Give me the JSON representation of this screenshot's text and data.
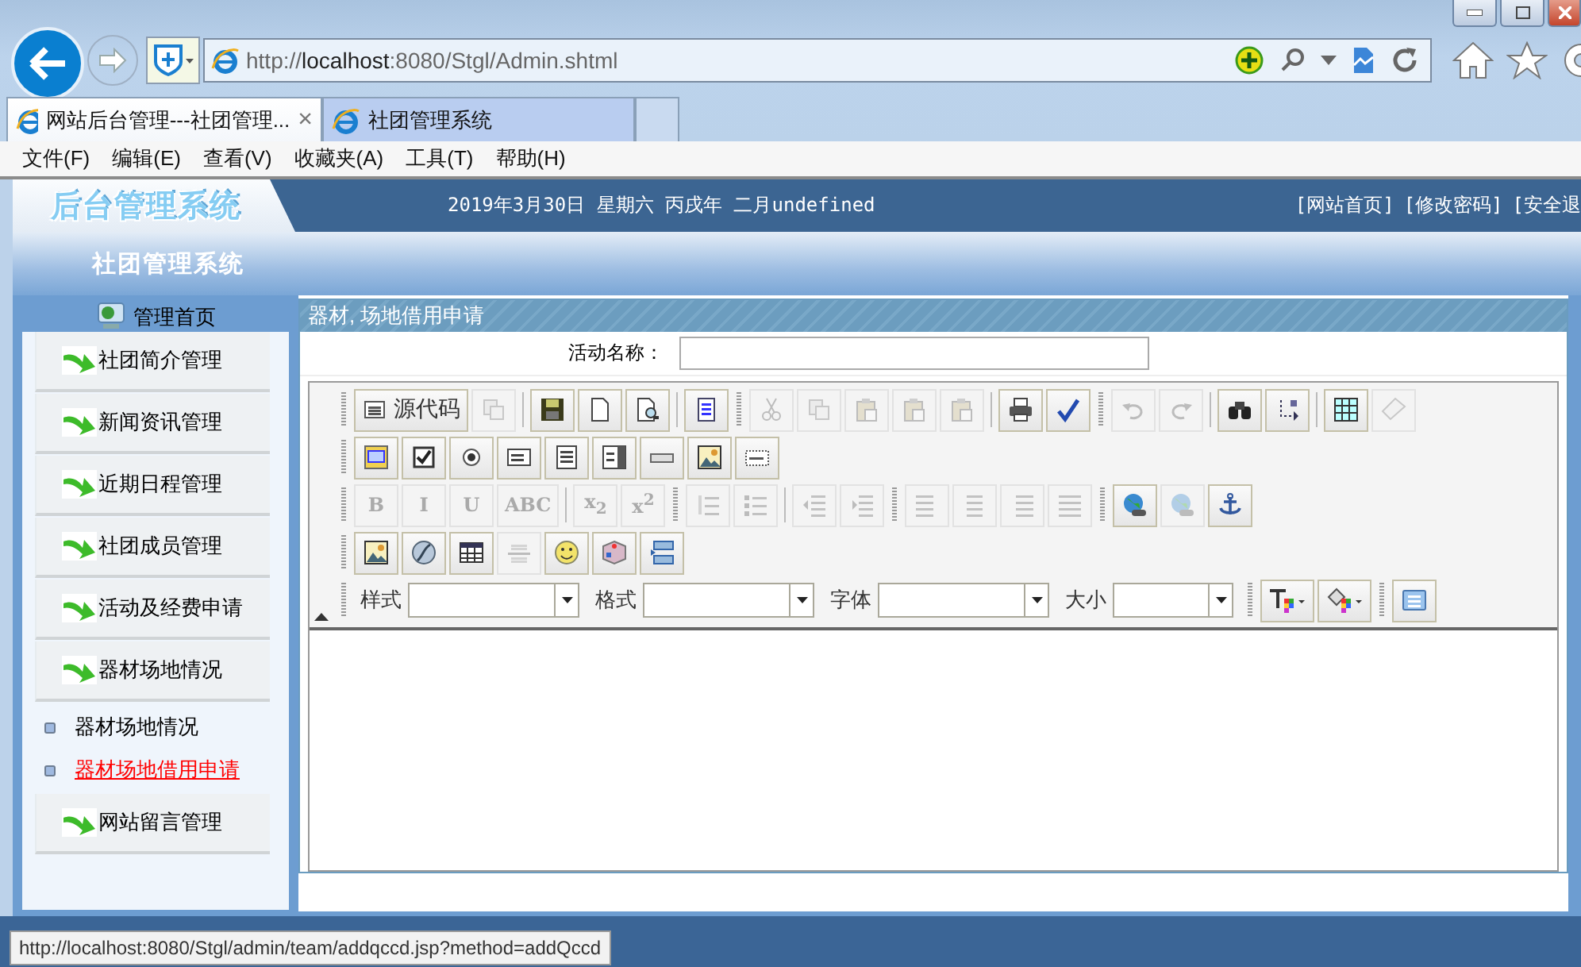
{
  "browser": {
    "address": "http://**localhost**:8080/Stgl/Admin.shtml",
    "tabs": [
      {
        "title": "网站后台管理---社团管理...",
        "selected": true,
        "close": "×"
      },
      {
        "title": "社团管理系统",
        "selected": false
      }
    ],
    "menu": [
      "文件(F)",
      "编辑(E)",
      "查看(V)",
      "收藏夹(A)",
      "工具(T)",
      "帮助(H)"
    ],
    "status_tooltip": "http://localhost:8080/Stgl/admin/team/addqccd.jsp?method=addQccd"
  },
  "header": {
    "logo": "后台管理系统",
    "date": "2019年3月30日 星期六 丙戌年 二月undefined",
    "links": [
      "[网站首页]",
      "[修改密码]",
      "[安全退"
    ],
    "system_title": "社团管理系统"
  },
  "sidebar": {
    "home": "管理首页",
    "items": [
      {
        "label": "社团简介管理"
      },
      {
        "label": "新闻资讯管理"
      },
      {
        "label": "近期日程管理"
      },
      {
        "label": "社团成员管理"
      },
      {
        "label": "活动及经费申请"
      },
      {
        "label": "器材场地情况",
        "children": [
          {
            "label": "器材场地情况",
            "selected": false
          },
          {
            "label": "器材场地借用申请",
            "selected": true
          }
        ]
      },
      {
        "label": "网站留言管理"
      }
    ]
  },
  "panel": {
    "title": "器材, 场地借用申请",
    "field_label": "活动名称：",
    "editor": {
      "rows": [
        {
          "toolbars": [
            {
              "groups": [
                [
                  {
                    "kind": "button",
                    "label": "源代码",
                    "disabled": false
                  },
                  {
                    "kind": "button",
                    "disabled": true
                  }
                ],
                [
                  {
                    "kind": "button",
                    "disabled": false
                  },
                  {
                    "kind": "button",
                    "disabled": false
                  },
                  {
                    "kind": "button",
                    "disabled": false
                  }
                ],
                [
                  {
                    "kind": "button",
                    "disabled": false
                  }
                ]
              ]
            },
            {
              "groups": [
                [
                  {
                    "kind": "button",
                    "disabled": true
                  },
                  {
                    "kind": "button",
                    "disabled": true
                  },
                  {
                    "kind": "button",
                    "disabled": true
                  },
                  {
                    "kind": "button",
                    "disabled": true
                  },
                  {
                    "kind": "button",
                    "disabled": true
                  }
                ],
                [
                  {
                    "kind": "button",
                    "disabled": false
                  },
                  {
                    "kind": "button",
                    "disabled": false
                  }
                ]
              ]
            },
            {
              "groups": [
                [
                  {
                    "kind": "button",
                    "disabled": true
                  },
                  {
                    "kind": "button",
                    "disabled": true
                  }
                ],
                [
                  {
                    "kind": "button",
                    "disabled": false
                  },
                  {
                    "kind": "button",
                    "disabled": false
                  }
                ],
                [
                  {
                    "kind": "button",
                    "disabled": false
                  },
                  {
                    "kind": "button",
                    "disabled": true
                  }
                ]
              ]
            }
          ]
        },
        {
          "toolbars": [
            {
              "groups": [
                [
                  {
                    "kind": "button",
                    "disabled": false
                  },
                  {
                    "kind": "button",
                    "disabled": false
                  },
                  {
                    "kind": "button",
                    "disabled": false
                  },
                  {
                    "kind": "button",
                    "disabled": false
                  },
                  {
                    "kind": "button",
                    "disabled": false
                  },
                  {
                    "kind": "button",
                    "disabled": false
                  },
                  {
                    "kind": "button",
                    "disabled": false
                  },
                  {
                    "kind": "button",
                    "disabled": false
                  },
                  {
                    "kind": "button",
                    "disabled": false
                  }
                ]
              ]
            }
          ]
        },
        {
          "toolbars": [
            {
              "groups": [
                [
                  {
                    "kind": "button",
                    "label": "B",
                    "disabled": true
                  },
                  {
                    "kind": "button",
                    "label": "I",
                    "disabled": true
                  },
                  {
                    "kind": "button",
                    "label": "U",
                    "disabled": true
                  },
                  {
                    "kind": "button",
                    "label": "ABC",
                    "disabled": true
                  }
                ],
                [
                  {
                    "kind": "button",
                    "label": "x$_{2}$",
                    "disabled": true
                  },
                  {
                    "kind": "button",
                    "label": "x$^{2}$",
                    "disabled": true
                  }
                ]
              ]
            },
            {
              "groups": [
                [
                  {
                    "kind": "button",
                    "disabled": true
                  },
                  {
                    "kind": "button",
                    "disabled": true
                  }
                ],
                [
                  {
                    "kind": "button",
                    "disabled": true
                  },
                  {
                    "kind": "button",
                    "disabled": true
                  }
                ]
              ]
            },
            {
              "groups": [
                [
                  {
                    "kind": "button",
                    "disabled": true
                  },
                  {
                    "kind": "button",
                    "disabled": true
                  },
                  {
                    "kind": "button",
                    "disabled": true
                  },
                  {
                    "kind": "button",
                    "disabled": true
                  }
                ]
              ]
            },
            {
              "groups": [
                [
                  {
                    "kind": "button",
                    "disabled": false
                  },
                  {
                    "kind": "button",
                    "disabled": true
                  },
                  {
                    "kind": "button",
                    "disabled": false
                  }
                ]
              ]
            }
          ]
        },
        {
          "toolbars": [
            {
              "groups": [
                [
                  {
                    "kind": "button",
                    "disabled": false
                  },
                  {
                    "kind": "button",
                    "disabled": false
                  },
                  {
                    "kind": "button",
                    "disabled": false
                  },
                  {
                    "kind": "button",
                    "disabled": true
                  },
                  {
                    "kind": "button",
                    "disabled": false
                  },
                  {
                    "kind": "button",
                    "disabled": false
                  },
                  {
                    "kind": "button",
                    "disabled": false
                  }
                ]
              ]
            }
          ]
        },
        {
          "toolbars": [
            {
              "groups": [
                [
                  {
                    "kind": "select",
                    "label": "样式"
                  },
                  {
                    "kind": "select",
                    "label": "格式"
                  },
                  {
                    "kind": "select",
                    "label": "字体"
                  },
                  {
                    "kind": "select",
                    "label": "大小"
                  }
                ]
              ]
            },
            {
              "groups": [
                [
                  {
                    "kind": "button",
                    "disabled": false
                  },
                  {
                    "kind": "button",
                    "disabled": false
                  }
                ]
              ]
            },
            {
              "groups": [
                [
                  {
                    "kind": "button",
                    "disabled": false
                  }
                ]
              ]
            }
          ]
        }
      ]
    }
  }
}
